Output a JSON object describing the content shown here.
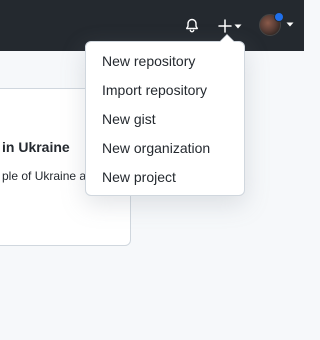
{
  "header": {
    "icons": [
      "bell-icon",
      "plus-icon",
      "caret-down-icon",
      "avatar"
    ],
    "colors": {
      "background": "#24292f",
      "icon": "#ffffff",
      "status_dot": "#1f6feb"
    }
  },
  "card": {
    "title": "in Ukraine",
    "text": "ple of Ukraine a"
  },
  "create_menu": {
    "items": [
      {
        "label": "New repository"
      },
      {
        "label": "Import repository"
      },
      {
        "label": "New gist"
      },
      {
        "label": "New organization"
      },
      {
        "label": "New project"
      }
    ]
  }
}
